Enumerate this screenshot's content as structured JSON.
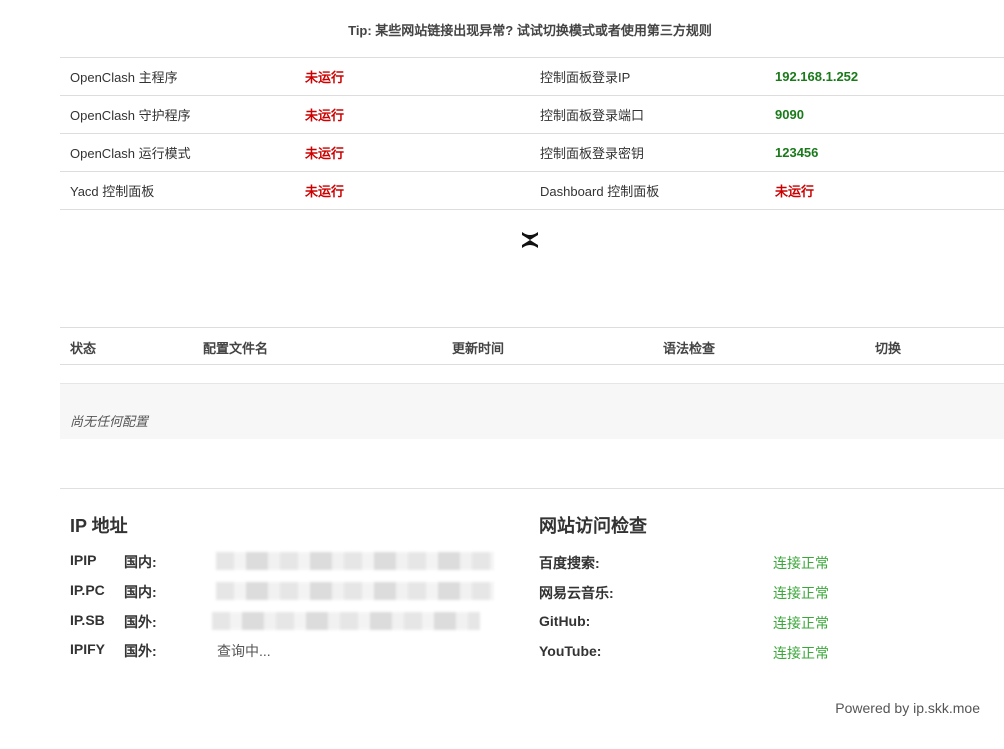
{
  "tip": "Tip: 某些网站链接出现异常? 试试切换模式或者使用第三方规则",
  "status_rows": [
    {
      "label": "OpenClash 主程序",
      "value": "未运行",
      "value_status": "red",
      "label2": "控制面板登录IP",
      "value2": "192.168.1.252",
      "value2_status": "green"
    },
    {
      "label": "OpenClash 守护程序",
      "value": "未运行",
      "value_status": "red",
      "label2": "控制面板登录端口",
      "value2": "9090",
      "value2_status": "green"
    },
    {
      "label": "OpenClash 运行模式",
      "value": "未运行",
      "value_status": "red",
      "label2": "控制面板登录密钥",
      "value2": "123456",
      "value2_status": "green"
    },
    {
      "label": "Yacd 控制面板",
      "value": "未运行",
      "value_status": "red",
      "label2": "Dashboard 控制面板",
      "value2": "未运行",
      "value2_status": "red"
    }
  ],
  "config_table": {
    "headers": [
      "状态",
      "配置文件名",
      "更新时间",
      "语法检查",
      "切换"
    ],
    "empty_text": "尚无任何配置"
  },
  "ip_section": {
    "title": "IP 地址",
    "rows": [
      {
        "source": "IPIP",
        "region": "国内:",
        "value": ""
      },
      {
        "source": "IP.PC",
        "region": "国内:",
        "value": ""
      },
      {
        "source": "IP.SB",
        "region": "国外:",
        "value": ""
      },
      {
        "source": "IPIFY",
        "region": "国外:",
        "value": "查询中..."
      }
    ]
  },
  "check_section": {
    "title": "网站访问检查",
    "rows": [
      {
        "site": "百度搜索:",
        "state": "连接正常"
      },
      {
        "site": "网易云音乐:",
        "state": "连接正常"
      },
      {
        "site": "GitHub:",
        "state": "连接正常"
      },
      {
        "site": "YouTube:",
        "state": "连接正常"
      }
    ]
  },
  "powered_by": "Powered by ip.skk.moe",
  "colors": {
    "red": "#cc0000",
    "green": "#1a7a1a",
    "ok": "#3aa83a"
  },
  "icons": {
    "logo": "openclash-x-logo-icon"
  }
}
